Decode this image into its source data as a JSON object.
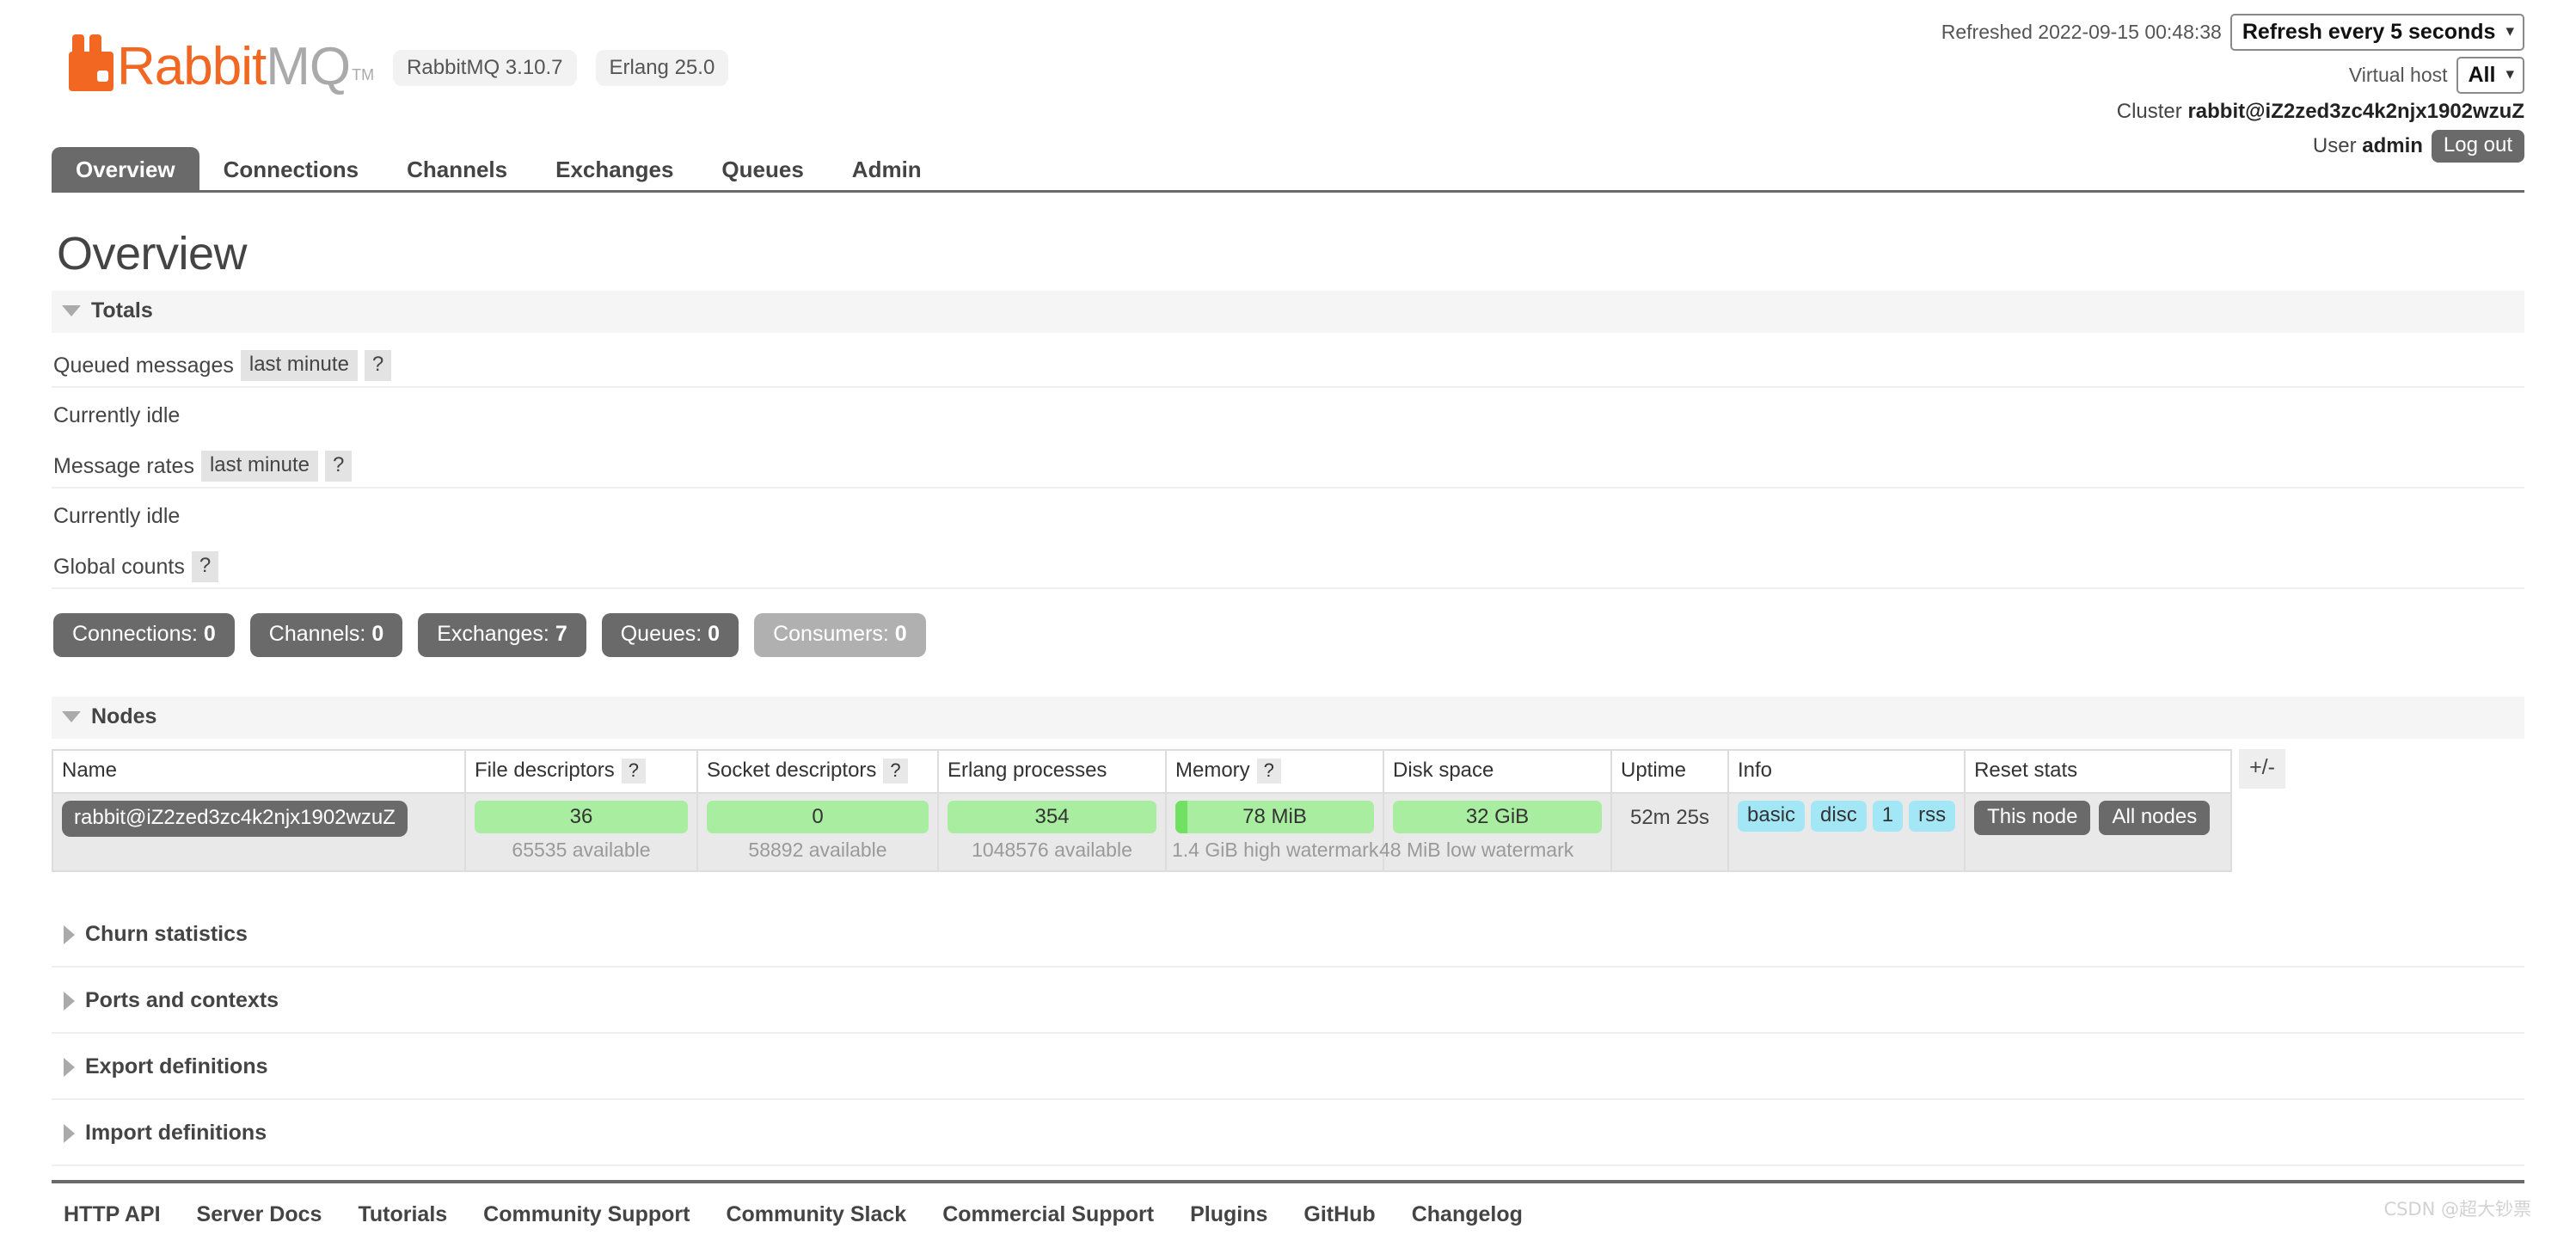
{
  "header": {
    "logo_rabbit": "Rabbit",
    "logo_mq": "MQ",
    "logo_tm": "TM",
    "rabbitmq_version": "RabbitMQ 3.10.7",
    "erlang_version": "Erlang 25.0",
    "refreshed_label": "Refreshed 2022-09-15 00:48:38",
    "refresh_select_value": "Refresh every 5 seconds",
    "vhost_label": "Virtual host",
    "vhost_select_value": "All",
    "cluster_label": "Cluster",
    "cluster_name": "rabbit@iZ2zed3zc4k2njx1902wzuZ",
    "user_label": "User",
    "user_name": "admin",
    "logout_label": "Log out"
  },
  "tabs": [
    {
      "label": "Overview",
      "active": true
    },
    {
      "label": "Connections",
      "active": false
    },
    {
      "label": "Channels",
      "active": false
    },
    {
      "label": "Exchanges",
      "active": false
    },
    {
      "label": "Queues",
      "active": false
    },
    {
      "label": "Admin",
      "active": false
    }
  ],
  "page_title": "Overview",
  "totals": {
    "section_label": "Totals",
    "queued_messages_label": "Queued messages",
    "queued_messages_period": "last minute",
    "queued_messages_help": "?",
    "queued_messages_status": "Currently idle",
    "message_rates_label": "Message rates",
    "message_rates_period": "last minute",
    "message_rates_help": "?",
    "message_rates_status": "Currently idle",
    "global_counts_label": "Global counts",
    "global_counts_help": "?"
  },
  "global_counts": [
    {
      "name": "Connections",
      "label": "Connections: ",
      "value": "0",
      "muted": false
    },
    {
      "name": "Channels",
      "label": "Channels: ",
      "value": "0",
      "muted": false
    },
    {
      "name": "Exchanges",
      "label": "Exchanges: ",
      "value": "7",
      "muted": false
    },
    {
      "name": "Queues",
      "label": "Queues: ",
      "value": "0",
      "muted": false
    },
    {
      "name": "Consumers",
      "label": "Consumers: ",
      "value": "0",
      "muted": true
    }
  ],
  "nodes": {
    "section_label": "Nodes",
    "columns": [
      {
        "label": "Name",
        "help": ""
      },
      {
        "label": "File descriptors",
        "help": "?"
      },
      {
        "label": "Socket descriptors",
        "help": "?"
      },
      {
        "label": "Erlang processes",
        "help": ""
      },
      {
        "label": "Memory",
        "help": "?"
      },
      {
        "label": "Disk space",
        "help": ""
      },
      {
        "label": "Uptime",
        "help": ""
      },
      {
        "label": "Info",
        "help": ""
      },
      {
        "label": "Reset stats",
        "help": ""
      }
    ],
    "plus_minus": "+/-",
    "row": {
      "name": "rabbit@iZ2zed3zc4k2njx1902wzuZ",
      "file_descriptors_value": "36",
      "file_descriptors_sub": "65535 available",
      "socket_descriptors_value": "0",
      "socket_descriptors_sub": "58892 available",
      "erlang_processes_value": "354",
      "erlang_processes_sub": "1048576 available",
      "memory_value": "78 MiB",
      "memory_sub": "1.4 GiB high watermark",
      "disk_space_value": "32 GiB",
      "disk_space_sub": "48 MiB low watermark",
      "uptime_value": "52m 25s",
      "info_tags": [
        "basic",
        "disc",
        "1",
        "rss"
      ],
      "reset_this_node": "This node",
      "reset_all_nodes": "All nodes"
    }
  },
  "collapsed_sections": [
    {
      "label": "Churn statistics"
    },
    {
      "label": "Ports and contexts"
    },
    {
      "label": "Export definitions"
    },
    {
      "label": "Import definitions"
    }
  ],
  "footer_links": [
    "HTTP API",
    "Server Docs",
    "Tutorials",
    "Community Support",
    "Community Slack",
    "Commercial Support",
    "Plugins",
    "GitHub",
    "Changelog"
  ],
  "watermark": "CSDN @超大钞票",
  "colors": {
    "brand_orange": "#f26722",
    "dark_grey": "#6a6a6a",
    "gauge_green": "#a8eda0",
    "gauge_fill": "#71e063",
    "tag_blue": "#a3e7f7"
  }
}
